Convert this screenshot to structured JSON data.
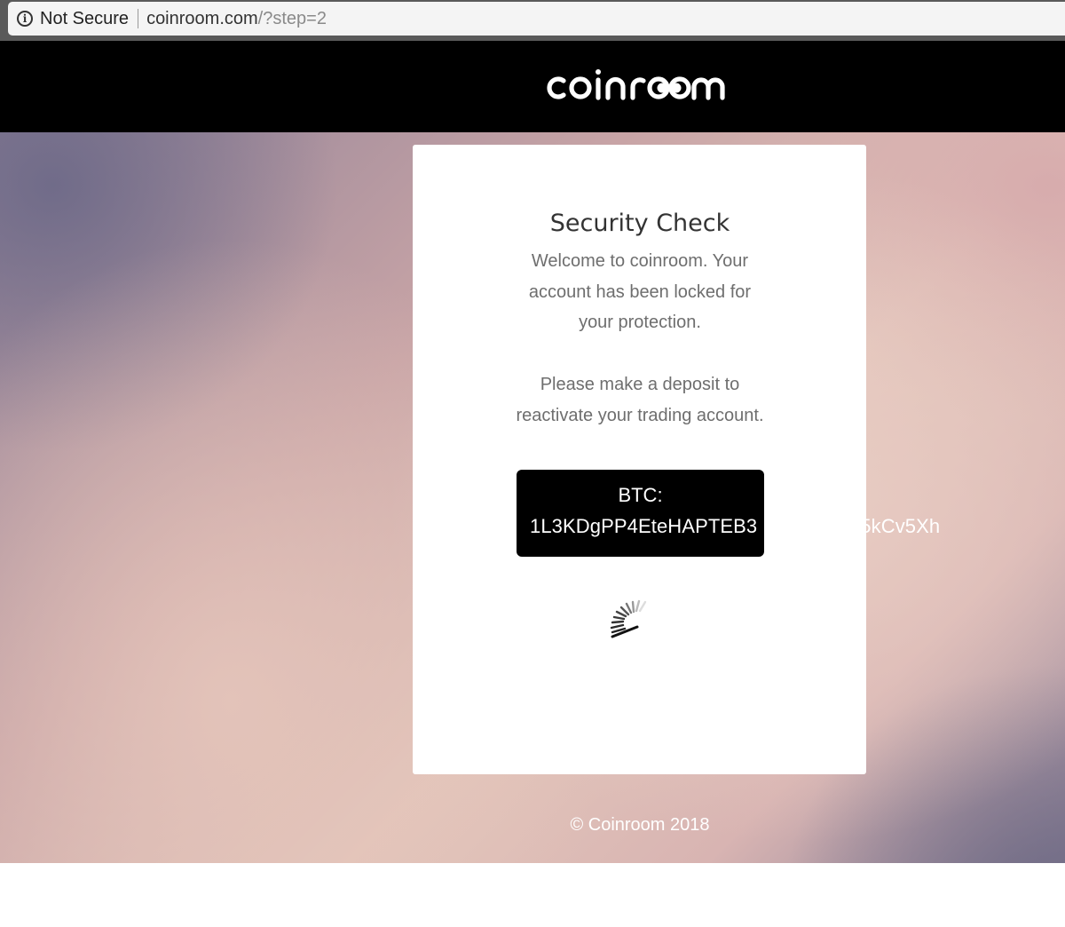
{
  "browser": {
    "security_label": "Not Secure",
    "url_host": "coinroom.com",
    "url_path": "/?step=2"
  },
  "header": {
    "logo_text": "coinroom"
  },
  "card": {
    "title": "Security Check",
    "message_lines_1": [
      "Welcome to coinroom. Your",
      "account has been locked for",
      "your protection."
    ],
    "message_lines_2": [
      "Please make a deposit to",
      "reactivate your trading account."
    ],
    "btc_label": "BTC:",
    "btc_address": "1L3KDgPP4EteHAPTEB3",
    "btc_address_tail": "5kCv5Xh"
  },
  "footer": {
    "copyright": "© Coinroom 2018"
  },
  "colors": {
    "header_bg": "#000000",
    "card_bg": "#ffffff",
    "btc_box_bg": "#000000",
    "title_text": "#333333",
    "body_text": "#6e6e6e"
  }
}
